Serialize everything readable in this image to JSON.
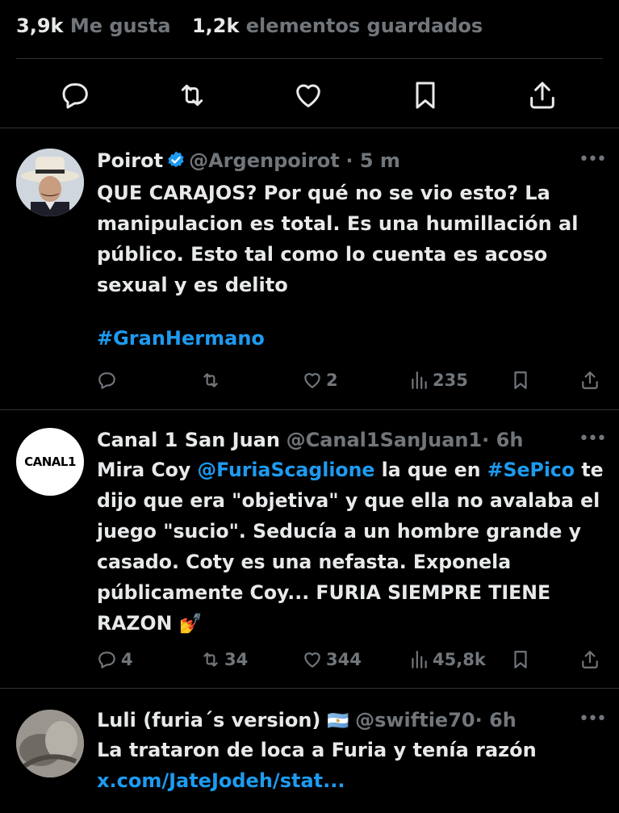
{
  "stats": {
    "likes_count": "3,9k",
    "likes_label": "Me gusta",
    "saves_count": "1,2k",
    "saves_label": "elementos guardados"
  },
  "main_actions": [
    "reply-icon",
    "retweet-icon",
    "like-icon",
    "bookmark-icon",
    "share-icon"
  ],
  "tweets": [
    {
      "name": "Poirot",
      "handle": "@Argenpoirot",
      "time": "· 5 m",
      "text": "QUE CARAJOS? Por qué no se vio esto? La manipulacion es total. Es una humillación al público. Esto tal como lo cuenta es acoso sexual y es delito",
      "hashtag": "#GranHermano",
      "replies": "",
      "retweets": "",
      "likes": "2",
      "views": "235"
    },
    {
      "name": "Canal 1 San Juan",
      "handle": "@Canal1SanJuan1",
      "time": "· 6h",
      "avatar_text": "CANAL1",
      "text_a": "Mira Coy ",
      "mention": "@FuriaScaglione",
      "text_b": " la que en ",
      "hashtag": "#SePico",
      "text_c": " te dijo que era \"objetiva\" y que ella no avalaba el juego \"sucio\". Seducía a un hombre grande y casado. Coty es una nefasta. Exponela públicamente Coy... FURIA SIEMPRE TIENE RAZON 💅",
      "replies": "4",
      "retweets": "34",
      "likes": "344",
      "views": "45,8k"
    },
    {
      "name": "Luli (furia´s version)",
      "flag": "🇦🇷",
      "handle": "@swiftie70",
      "time": "· 6h",
      "text": "La trataron de loca a Furia y tenía razón",
      "link": "x.com/JateJodeh/stat..."
    }
  ],
  "colors": {
    "background": "#000000",
    "text": "#e7e9ea",
    "muted": "#71767b",
    "link": "#1d9bf0",
    "verified": "#1d9bf0",
    "divider": "#2f3336"
  }
}
